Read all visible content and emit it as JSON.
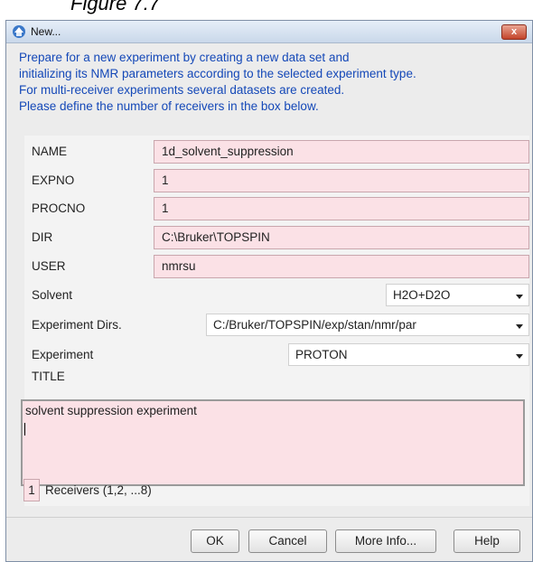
{
  "page_caption": "Figure 7.7",
  "window": {
    "title": "New...",
    "close_label": "x"
  },
  "description": [
    "Prepare for a new experiment by creating a new data set and",
    "initializing its NMR parameters according to the selected experiment type.",
    "For multi-receiver experiments several datasets are created.",
    "Please define the number of receivers in the box below."
  ],
  "fields": {
    "name": {
      "label": "NAME",
      "value": "1d_solvent_suppression"
    },
    "expno": {
      "label": "EXPNO",
      "value": "1"
    },
    "procno": {
      "label": "PROCNO",
      "value": "1"
    },
    "dir": {
      "label": "DIR",
      "value": "C:\\Bruker\\TOPSPIN"
    },
    "user": {
      "label": "USER",
      "value": "nmrsu"
    }
  },
  "solvent": {
    "label": "Solvent",
    "value": "H2O+D2O"
  },
  "experiment_dirs": {
    "label": "Experiment Dirs.",
    "value": "C:/Bruker/TOPSPIN/exp/stan/nmr/par"
  },
  "experiment": {
    "label": "Experiment",
    "value": "PROTON"
  },
  "title": {
    "label": "TITLE",
    "value": "solvent suppression experiment"
  },
  "receivers": {
    "count": "1",
    "label": "Receivers (1,2, ...8)"
  },
  "buttons": {
    "ok": "OK",
    "cancel": "Cancel",
    "more_info": "More Info...",
    "help": "Help"
  },
  "colors": {
    "description_text": "#1448b8",
    "field_background": "#fbe1e6",
    "close_button": "#c3442a"
  }
}
